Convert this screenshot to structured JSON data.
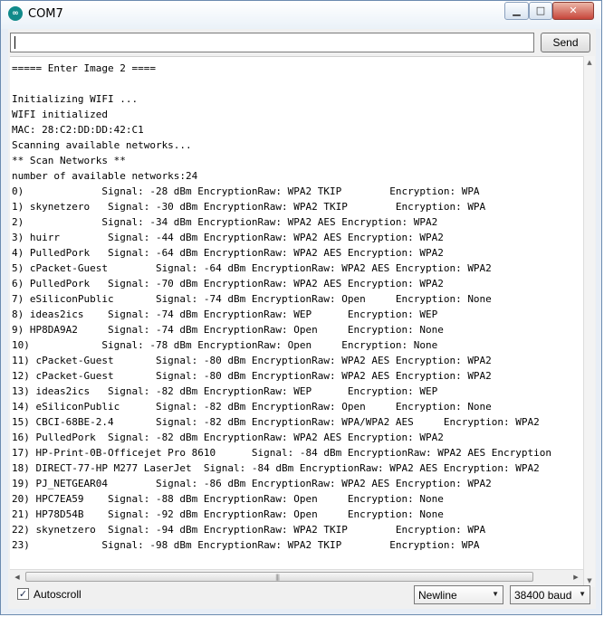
{
  "window": {
    "title": "COM7",
    "app_icon": "arduino-icon"
  },
  "toolbar": {
    "input_value": "",
    "send_label": "Send"
  },
  "console": {
    "lines": [
      "===== Enter Image 2 ====",
      "",
      "Initializing WIFI ...",
      "WIFI initialized",
      "MAC: 28:C2:DD:DD:42:C1",
      "Scanning available networks...",
      "** Scan Networks **",
      "number of available networks:24",
      "0)             Signal: -28 dBm EncryptionRaw: WPA2 TKIP        Encryption: WPA",
      "1) skynetzero   Signal: -30 dBm EncryptionRaw: WPA2 TKIP        Encryption: WPA",
      "2)             Signal: -34 dBm EncryptionRaw: WPA2 AES Encryption: WPA2",
      "3) huirr        Signal: -44 dBm EncryptionRaw: WPA2 AES Encryption: WPA2",
      "4) PulledPork   Signal: -64 dBm EncryptionRaw: WPA2 AES Encryption: WPA2",
      "5) cPacket-Guest        Signal: -64 dBm EncryptionRaw: WPA2 AES Encryption: WPA2",
      "6) PulledPork   Signal: -70 dBm EncryptionRaw: WPA2 AES Encryption: WPA2",
      "7) eSiliconPublic       Signal: -74 dBm EncryptionRaw: Open     Encryption: None",
      "8) ideas2ics    Signal: -74 dBm EncryptionRaw: WEP      Encryption: WEP",
      "9) HP8DA9A2     Signal: -74 dBm EncryptionRaw: Open     Encryption: None",
      "10)            Signal: -78 dBm EncryptionRaw: Open     Encryption: None",
      "11) cPacket-Guest       Signal: -80 dBm EncryptionRaw: WPA2 AES Encryption: WPA2",
      "12) cPacket-Guest       Signal: -80 dBm EncryptionRaw: WPA2 AES Encryption: WPA2",
      "13) ideas2ics   Signal: -82 dBm EncryptionRaw: WEP      Encryption: WEP",
      "14) eSiliconPublic      Signal: -82 dBm EncryptionRaw: Open     Encryption: None",
      "15) CBCI-68BE-2.4       Signal: -82 dBm EncryptionRaw: WPA/WPA2 AES     Encryption: WPA2",
      "16) PulledPork  Signal: -82 dBm EncryptionRaw: WPA2 AES Encryption: WPA2",
      "17) HP-Print-0B-Officejet Pro 8610      Signal: -84 dBm EncryptionRaw: WPA2 AES Encryption",
      "18) DIRECT-77-HP M277 LaserJet  Signal: -84 dBm EncryptionRaw: WPA2 AES Encryption: WPA2",
      "19) PJ_NETGEAR04        Signal: -86 dBm EncryptionRaw: WPA2 AES Encryption: WPA2",
      "20) HPC7EA59    Signal: -88 dBm EncryptionRaw: Open     Encryption: None",
      "21) HP78D54B    Signal: -92 dBm EncryptionRaw: Open     Encryption: None",
      "22) skynetzero  Signal: -94 dBm EncryptionRaw: WPA2 TKIP        Encryption: WPA",
      "23)            Signal: -98 dBm EncryptionRaw: WPA2 TKIP        Encryption: WPA"
    ]
  },
  "footer": {
    "autoscroll_label": "Autoscroll",
    "autoscroll_checked": true,
    "line_ending": "Newline",
    "baud_rate": "38400 baud"
  },
  "colors": {
    "titlebar": "#eaf1f8",
    "close_button": "#c7453a",
    "console_bg": "#ffffff",
    "panel_bg": "#f0f0f0"
  }
}
